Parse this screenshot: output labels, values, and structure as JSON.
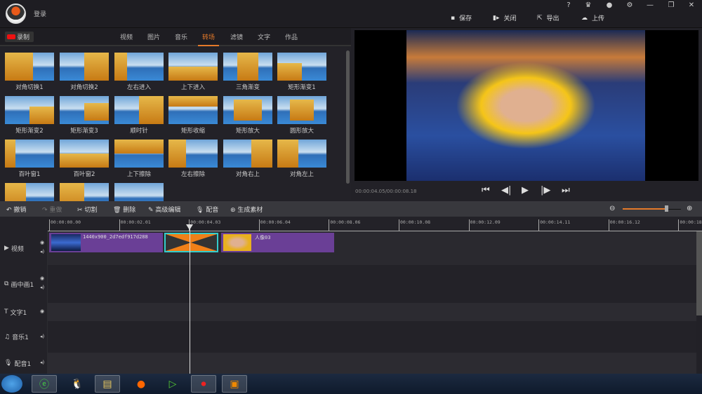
{
  "header": {
    "login": "登录",
    "actions": [
      {
        "label": "保存",
        "icon": "save-icon"
      },
      {
        "label": "关闭",
        "icon": "exit-icon"
      },
      {
        "label": "导出",
        "icon": "export-icon"
      },
      {
        "label": "上传",
        "icon": "upload-icon"
      }
    ],
    "window_icons": [
      "help-icon",
      "vip-icon",
      "qq-icon",
      "gear-icon",
      "minimize-icon",
      "restore-icon",
      "close-icon"
    ],
    "help": "?"
  },
  "library": {
    "record": "录制",
    "tabs": [
      "视频",
      "图片",
      "音乐",
      "转场",
      "滤镜",
      "文字",
      "作品"
    ],
    "active_tab": "转场",
    "transitions": [
      "对角切换1",
      "对角切换2",
      "左右进入",
      "上下进入",
      "三角渐变",
      "矩形渐变1",
      "矩形渐变2",
      "矩形渐变3",
      "顺时针",
      "矩形收缩",
      "矩形放大",
      "圆形放大",
      "百叶窗1",
      "百叶窗2",
      "上下擦除",
      "左右擦除",
      "对角右上",
      "对角左上",
      "",
      "",
      ""
    ]
  },
  "preview": {
    "time": "00:00:04.05/00:00:08.18"
  },
  "toolbar": {
    "undo": "撤销",
    "redo": "重做",
    "cut": "切割",
    "delete": "删除",
    "advanced": "高级编辑",
    "dub": "配音",
    "generate": "生成素材",
    "zoom_level": 0.75
  },
  "timeline": {
    "ticks": [
      "00:00:00.00",
      "00:00:02.01",
      "00:00:04.03",
      "00:00:06.04",
      "00:00:08.06",
      "00:00:10.08",
      "00:00:12.09",
      "00:00:14.11",
      "00:00:16.12",
      "00:00:18.1"
    ],
    "tracks": [
      {
        "label": "视频",
        "icon": "play-box-icon"
      },
      {
        "label": "画中画1",
        "icon": "pip-icon"
      },
      {
        "label": "文字1",
        "icon": "text-icon"
      },
      {
        "label": "音乐1",
        "icon": "music-icon"
      },
      {
        "label": "配音1",
        "icon": "mic-icon"
      }
    ],
    "clips": {
      "video1": "1440x900_2d7edf917d288",
      "video2": "人像03"
    },
    "accent": "#e57a2a",
    "clip_color": "#6a3f96"
  }
}
